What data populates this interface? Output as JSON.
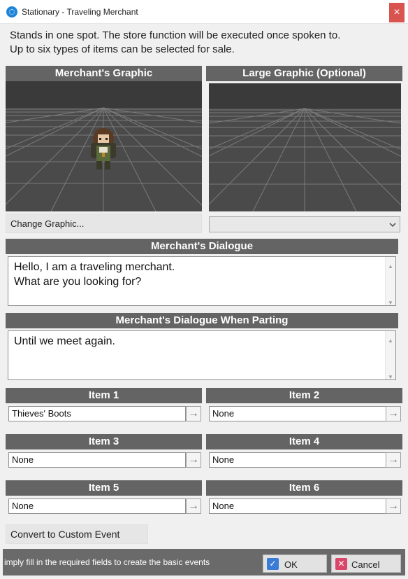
{
  "window": {
    "title": "Stationary - Traveling Merchant",
    "close_glyph": "×"
  },
  "description": [
    "Stands in one spot.  The store function will be executed once spoken to.",
    "Up to six types of items can be selected for sale."
  ],
  "graphic": {
    "merchant_header": "Merchant's Graphic",
    "large_header": "Large Graphic (Optional)",
    "change_button": "Change Graphic...",
    "large_select_value": ""
  },
  "dialogue": {
    "header": "Merchant's Dialogue",
    "lines": [
      "Hello, I am a traveling merchant.",
      "What are you looking for?"
    ]
  },
  "parting": {
    "header": "Merchant's Dialogue When Parting",
    "lines": [
      "Until we meet again."
    ]
  },
  "items": [
    {
      "header": "Item 1",
      "value": "Thieves' Boots"
    },
    {
      "header": "Item 2",
      "value": "None"
    },
    {
      "header": "Item 3",
      "value": "None"
    },
    {
      "header": "Item 4",
      "value": "None"
    },
    {
      "header": "Item 5",
      "value": "None"
    },
    {
      "header": "Item 6",
      "value": "None"
    }
  ],
  "convert_button": "Convert to Custom Event",
  "footer": {
    "hint": "imply fill in the required fields to create the basic events",
    "ok_label": "OK",
    "cancel_label": "Cancel"
  },
  "icons": {
    "arrow": "arrow-right-icon",
    "ok": "check-icon",
    "cancel": "x-icon",
    "dropdown": "chevron-down-icon"
  },
  "colors": {
    "header_bg": "#646464",
    "ok_accent": "#3a7bd5",
    "cancel_accent": "#d9466a",
    "close_bg": "#d9534f"
  }
}
